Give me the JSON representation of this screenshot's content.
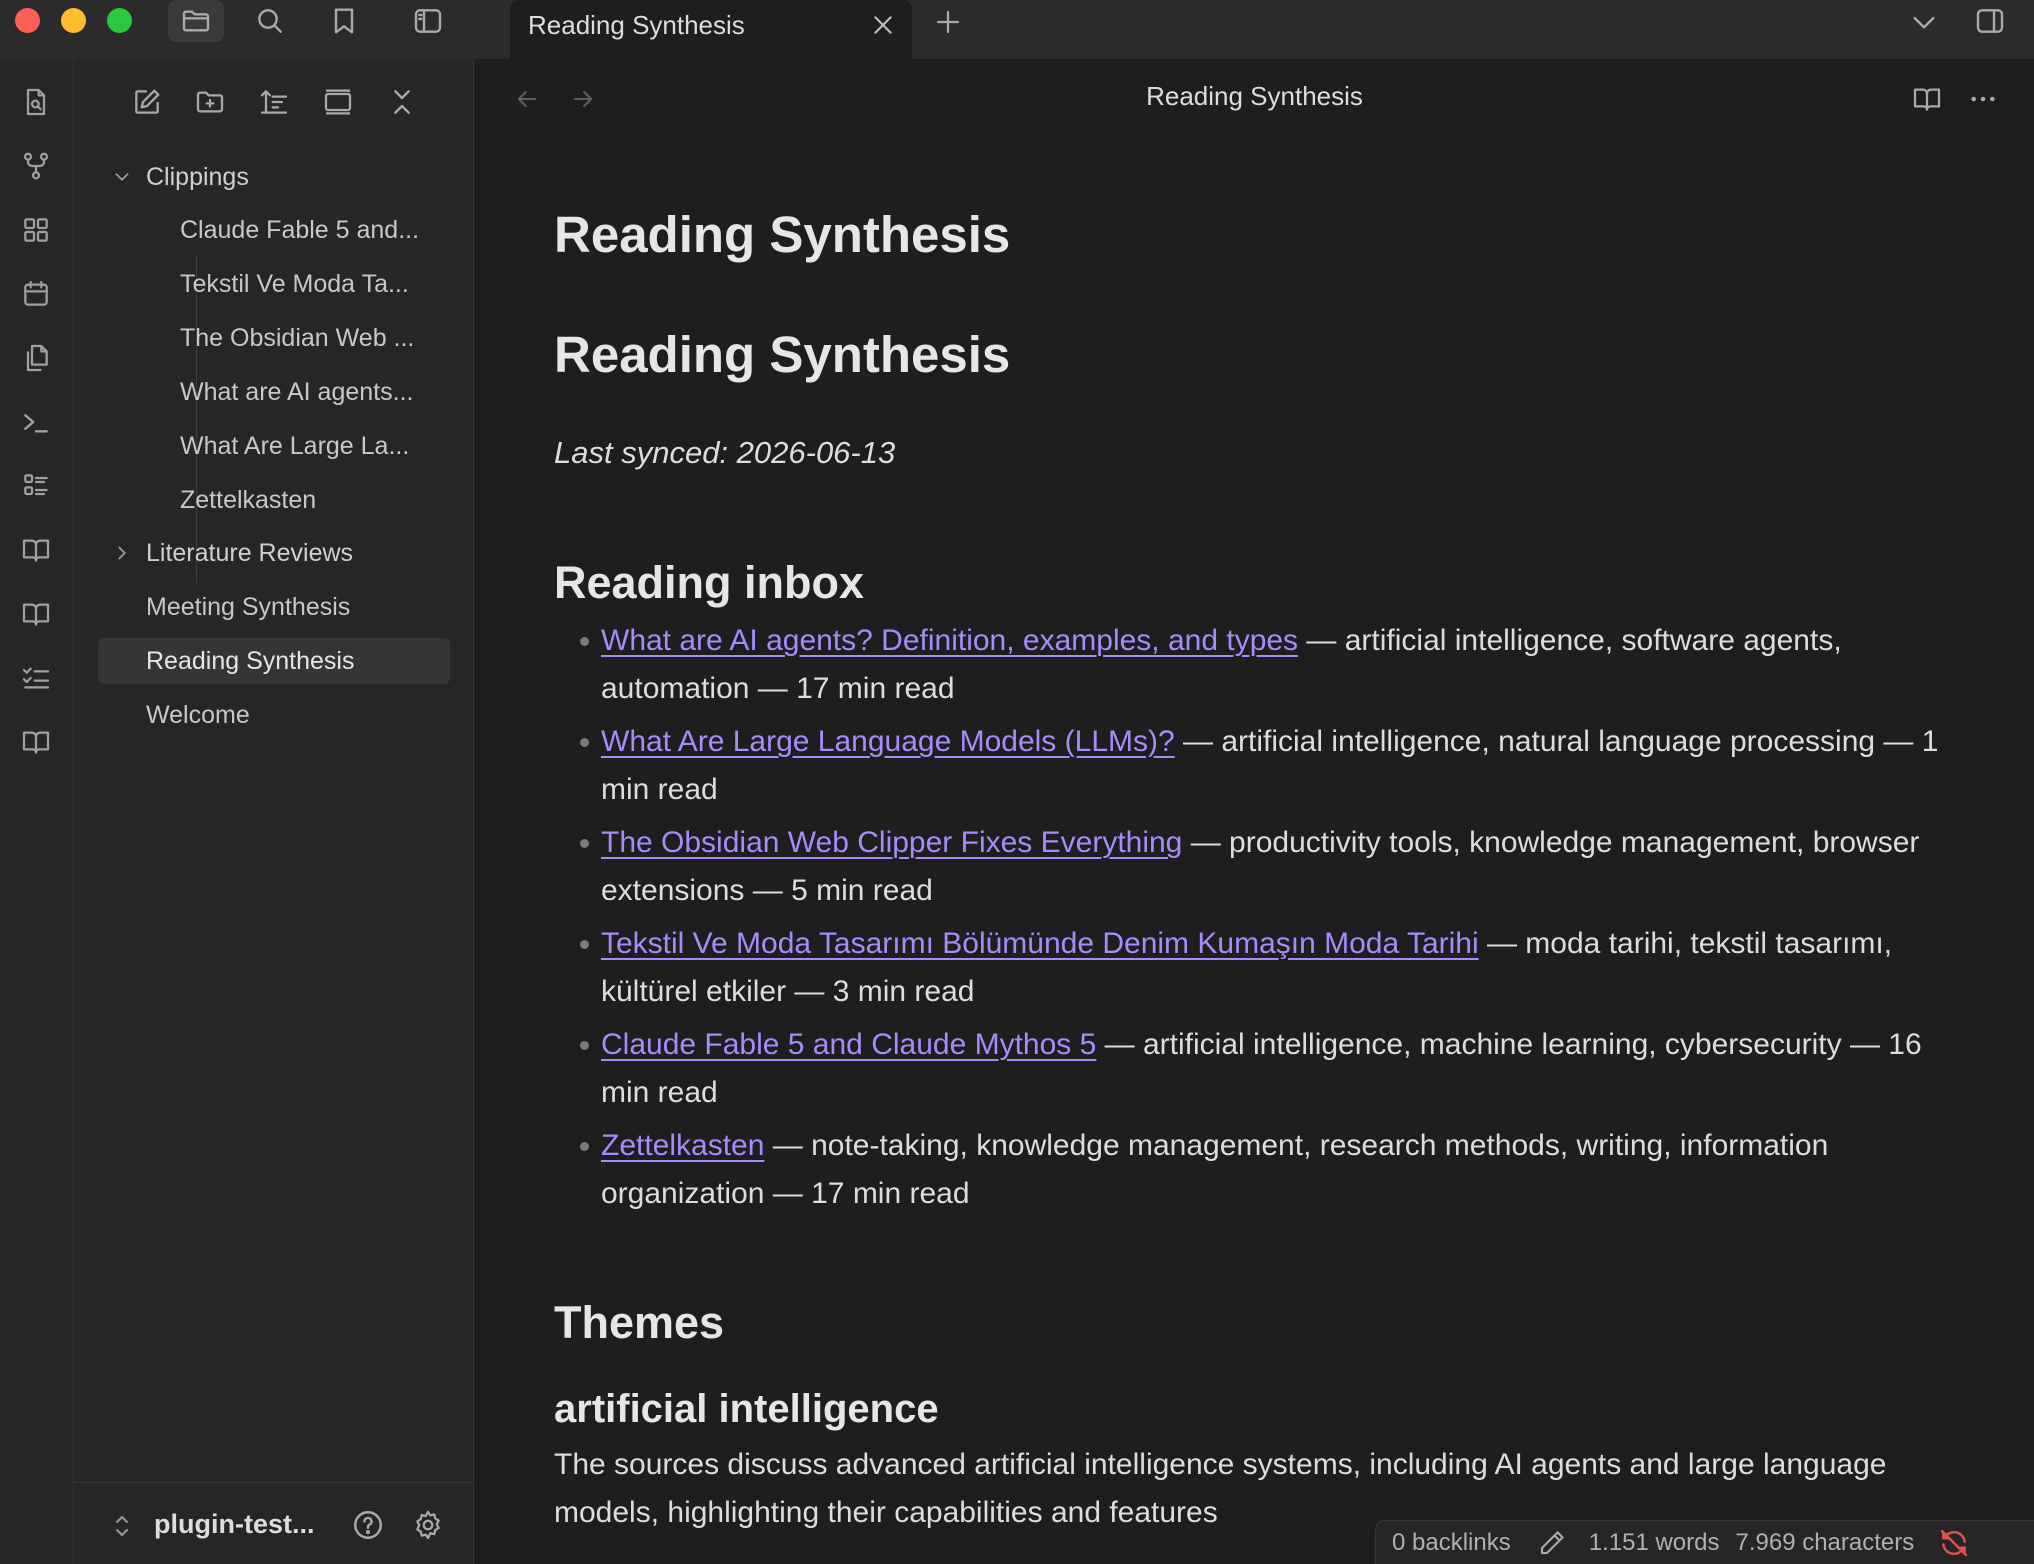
{
  "tabs": [
    {
      "title": "Reading Synthesis"
    }
  ],
  "explorer": {
    "tree": [
      {
        "label": "Clippings"
      },
      {
        "label": "Claude Fable 5 and..."
      },
      {
        "label": "Tekstil Ve Moda Ta..."
      },
      {
        "label": "The Obsidian Web ..."
      },
      {
        "label": "What are AI agents..."
      },
      {
        "label": "What Are Large La..."
      },
      {
        "label": "Zettelkasten"
      },
      {
        "label": "Literature Reviews"
      },
      {
        "label": "Meeting Synthesis"
      },
      {
        "label": "Reading Synthesis"
      },
      {
        "label": "Welcome"
      }
    ],
    "vault_name": "plugin-test..."
  },
  "editor": {
    "view_title": "Reading Synthesis",
    "h1_a": "Reading Synthesis",
    "h1_b": "Reading Synthesis",
    "synced": "Last synced: 2026-06-13",
    "inbox_heading": "Reading inbox",
    "inbox": [
      {
        "title": "What are AI agents? Definition, examples, and types",
        "desc": " — artificial intelligence, software agents, automation — 17 min read"
      },
      {
        "title": "What Are Large Language Models (LLMs)?",
        "desc": " — artificial intelligence, natural language processing — 1 min read"
      },
      {
        "title": "The Obsidian Web Clipper Fixes Everything",
        "desc": " — productivity tools, knowledge management, browser extensions — 5 min read"
      },
      {
        "title": "Tekstil Ve Moda Tasarımı Bölümünde Denim Kumaşın Moda Tarihi",
        "desc": " — moda tarihi, tekstil tasarımı, kültürel etkiler — 3 min read"
      },
      {
        "title": "Claude Fable 5 and Claude Mythos 5",
        "desc": " — artificial intelligence, machine learning, cybersecurity — 16 min read"
      },
      {
        "title": "Zettelkasten",
        "desc": " — note-taking, knowledge management, research methods, writing, information organization — 17 min read"
      }
    ],
    "themes_heading": "Themes",
    "theme_heading": "artificial intelligence",
    "theme_paragraph": "The sources discuss advanced artificial intelligence systems, including AI agents and large language models, highlighting their capabilities and features"
  },
  "status": {
    "backlinks": "0 backlinks",
    "words": "1.151 words",
    "characters": "7.969 characters"
  },
  "colors": {
    "accent_link": "#a78bfa",
    "background": "#1e1e1e",
    "sidebar": "#262626",
    "sync_error": "#e05252"
  }
}
